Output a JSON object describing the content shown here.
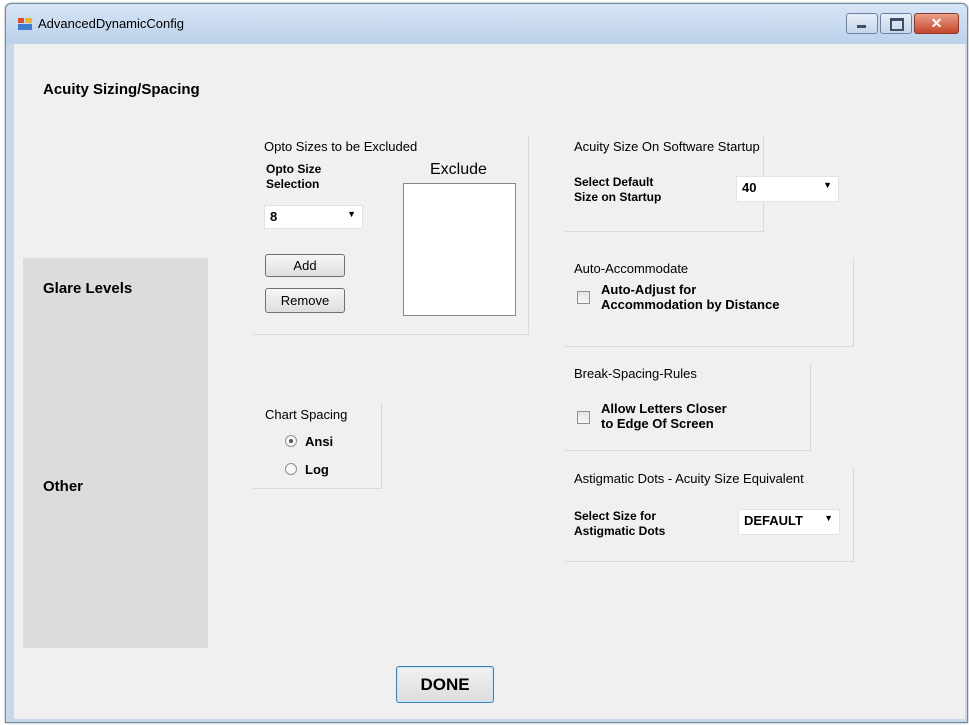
{
  "window": {
    "title": "AdvancedDynamicConfig",
    "close_glyph": "✕",
    "icons": [
      "app-icon",
      "minimize-icon",
      "maximize-icon",
      "close-icon"
    ]
  },
  "tabs": [
    {
      "label": "Acuity Sizing/Spacing",
      "active": true
    },
    {
      "label": "Glare Levels",
      "active": false
    },
    {
      "label": "Other",
      "active": false
    }
  ],
  "opto_exclude": {
    "group_title": "Opto Sizes to be Excluded",
    "selection_label": "Opto Size\nSelection",
    "selected_value": "8",
    "exclude_header": "Exclude",
    "exclude_items": [],
    "add_label": "Add",
    "remove_label": "Remove"
  },
  "chart_spacing": {
    "title": "Chart Spacing",
    "options": [
      {
        "label": "Ansi",
        "checked": true
      },
      {
        "label": "Log",
        "checked": false
      }
    ]
  },
  "acuity_startup": {
    "title": "Acuity Size On Software Startup",
    "label": "Select Default\nSize on Startup",
    "value": "40"
  },
  "auto_accommodate": {
    "title": "Auto-Accommodate",
    "checkbox_label": "Auto-Adjust for\nAccommodation by Distance",
    "checked": false
  },
  "break_spacing": {
    "title": "Break-Spacing-Rules",
    "checkbox_label": "Allow Letters Closer\nto Edge Of Screen",
    "checked": false
  },
  "astigmatic": {
    "title": "Astigmatic Dots - Acuity Size Equivalent",
    "label": "Select Size for\nAstigmatic Dots",
    "value": "DEFAULT"
  },
  "dropdown_arrow": "▼",
  "done_label": "DONE"
}
